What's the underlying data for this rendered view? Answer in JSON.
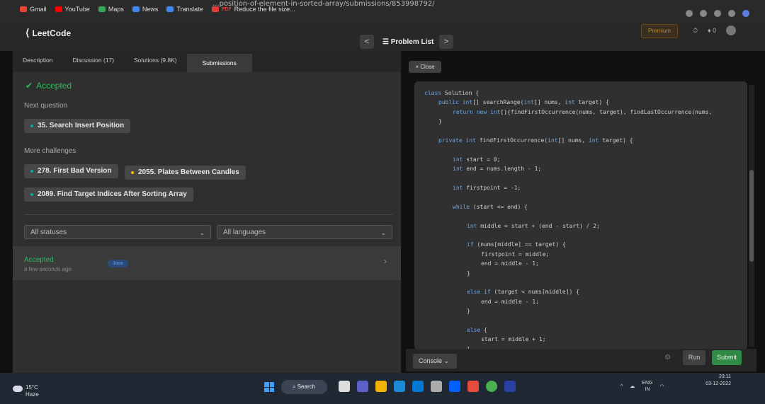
{
  "browser": {
    "url": "...position-of-element-in-sorted-array/submissions/853998792/",
    "bookmarks": [
      {
        "label": "Gmail",
        "color": "#ea4335"
      },
      {
        "label": "YouTube",
        "color": "#ff0000"
      },
      {
        "label": "Maps",
        "color": "#34a853"
      },
      {
        "label": "News",
        "color": "#4285f4"
      },
      {
        "label": "Translate",
        "color": "#4285f4"
      },
      {
        "label": "Reduce the file size...",
        "color": "#e53935",
        "prefix": "PDF"
      }
    ]
  },
  "header": {
    "logo": "LeetCode",
    "prev": "<",
    "problem_list": "Problem List",
    "next": ">",
    "premium": "Premium",
    "streak": "0"
  },
  "left": {
    "tabs": [
      {
        "label": "Description"
      },
      {
        "label": "Discussion (17)"
      },
      {
        "label": "Solutions (9.8K)"
      },
      {
        "label": "Submissions"
      }
    ],
    "accepted": "Accepted",
    "next_question_label": "Next question",
    "next_question": "35. Search Insert Position",
    "more_label": "More challenges",
    "challenges": [
      {
        "label": "278. First Bad Version",
        "dot": "#00af9b"
      },
      {
        "label": "2055. Plates Between Candles",
        "dot": "#ffb800"
      },
      {
        "label": "2089. Find Target Indices After Sorting Array",
        "dot": "#00af9b"
      }
    ],
    "status_filter": "All statuses",
    "lang_filter": "All languages",
    "submission": {
      "status": "Accepted",
      "time": "a few seconds ago",
      "lang": "Java"
    }
  },
  "code": {
    "close": "× Close",
    "lines": [
      {
        "t": "class Solution {",
        "i": 0
      },
      {
        "t": "public int[] searchRange(int[] nums, int target) {",
        "i": 1
      },
      {
        "t": "return new int[]{findFirstOccurrence(nums, target), findLastOccurrence(nums,",
        "i": 2
      },
      {
        "t": "}",
        "i": 1
      },
      {
        "t": "",
        "i": 0
      },
      {
        "t": "private int findFirstOccurrence(int[] nums, int target) {",
        "i": 1
      },
      {
        "t": "",
        "i": 0
      },
      {
        "t": "int start = 0;",
        "i": 2
      },
      {
        "t": "int end = nums.length - 1;",
        "i": 2
      },
      {
        "t": "",
        "i": 0
      },
      {
        "t": "int firstpoint = -1;",
        "i": 2
      },
      {
        "t": "",
        "i": 0
      },
      {
        "t": "while (start <= end) {",
        "i": 2
      },
      {
        "t": "",
        "i": 0
      },
      {
        "t": "int middle = start + (end - start) / 2;",
        "i": 3
      },
      {
        "t": "",
        "i": 0
      },
      {
        "t": "if (nums[middle] == target) {",
        "i": 3
      },
      {
        "t": "firstpoint = middle;",
        "i": 4
      },
      {
        "t": "end = middle - 1;",
        "i": 4
      },
      {
        "t": "}",
        "i": 3
      },
      {
        "t": "",
        "i": 0
      },
      {
        "t": "else if (target < nums[middle]) {",
        "i": 3
      },
      {
        "t": "end = middle - 1;",
        "i": 4
      },
      {
        "t": "}",
        "i": 3
      },
      {
        "t": "",
        "i": 0
      },
      {
        "t": "else {",
        "i": 3
      },
      {
        "t": "start = middle + 1;",
        "i": 4
      },
      {
        "t": "}",
        "i": 3
      }
    ]
  },
  "bottom": {
    "console": "Console",
    "run": "Run",
    "submit": "Submit"
  },
  "taskbar": {
    "temp": "15°C",
    "weather": "Haze",
    "search": "Search",
    "lang": "ENG",
    "region": "IN",
    "time": "23:11",
    "date": "03-12-2022"
  }
}
